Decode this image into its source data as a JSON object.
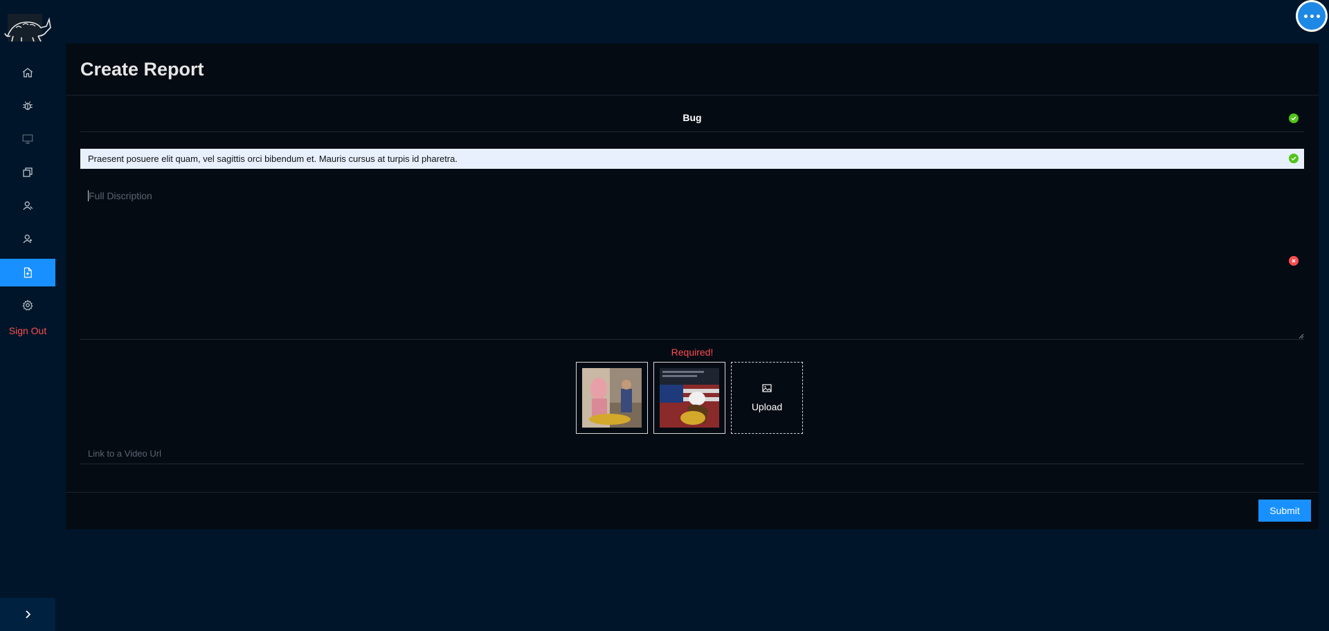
{
  "app": {
    "logo": "armadillo-logo"
  },
  "sidebar": {
    "items": [
      {
        "id": "home",
        "icon": "home-icon"
      },
      {
        "id": "bugs",
        "icon": "bug-icon"
      },
      {
        "id": "desktop",
        "icon": "desktop-icon"
      },
      {
        "id": "copy",
        "icon": "copy-icon"
      },
      {
        "id": "users",
        "icon": "user-icon"
      },
      {
        "id": "team",
        "icon": "team-icon"
      },
      {
        "id": "create-report",
        "icon": "file-add-icon",
        "active": true
      },
      {
        "id": "settings",
        "icon": "gear-icon"
      }
    ],
    "sign_out_label": "Sign Out",
    "collapse_icon": "chevron-right-icon"
  },
  "page": {
    "title": "Create Report"
  },
  "form": {
    "type_value": "Bug",
    "title_value": "Praesent posuere elit quam, vel sagittis orci bibendum et. Mauris cursus at turpis id pharetra.",
    "description_placeholder": "Full Discription",
    "required_message": "Required!",
    "upload_label": "Upload",
    "video_placeholder": "Link to a Video Url",
    "submit_label": "Submit"
  },
  "colors": {
    "accent": "#1890ff",
    "success": "#52c41a",
    "error": "#ff4d4f",
    "background": "#001529",
    "card": "#050b13"
  }
}
